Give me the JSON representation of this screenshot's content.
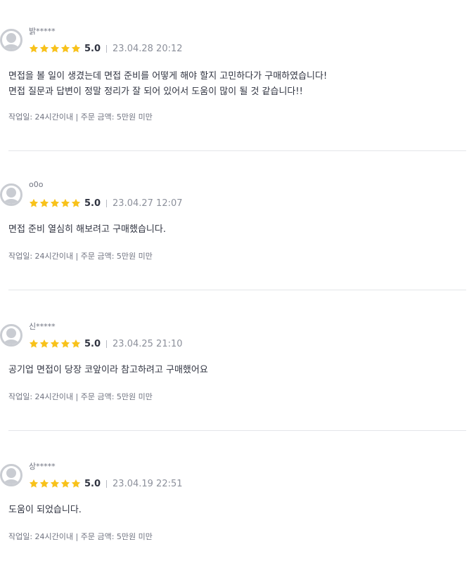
{
  "star_color": "#f8c21b",
  "reviews": [
    {
      "name": "밝*****",
      "rating": "5.0",
      "date": "23.04.28 20:12",
      "lines": [
        "면접을 볼 일이 생겼는데 면접 준비를 어떻게 해야 할지 고민하다가 구매하였습니다!",
        "면접 질문과 답변이 정말 정리가 잘 되어 있어서 도움이 많이 될 것 같습니다!!"
      ],
      "tags": "작업일: 24시간이내 | 주문 금액: 5만원 미만"
    },
    {
      "name": "o0o",
      "rating": "5.0",
      "date": "23.04.27 12:07",
      "lines": [
        "면접 준비 열심히 해보려고 구매했습니다."
      ],
      "tags": "작업일: 24시간이내 | 주문 금액: 5만원 미만"
    },
    {
      "name": "신*****",
      "rating": "5.0",
      "date": "23.04.25 21:10",
      "lines": [
        "공기업 면접이 당장 코앞이라 참고하려고 구매했어요"
      ],
      "tags": "작업일: 24시간이내 | 주문 금액: 5만원 미만"
    },
    {
      "name": "상*****",
      "rating": "5.0",
      "date": "23.04.19 22:51",
      "lines": [
        "도움이 되었습니다."
      ],
      "tags": "작업일: 24시간이내 | 주문 금액: 5만원 미만"
    }
  ]
}
